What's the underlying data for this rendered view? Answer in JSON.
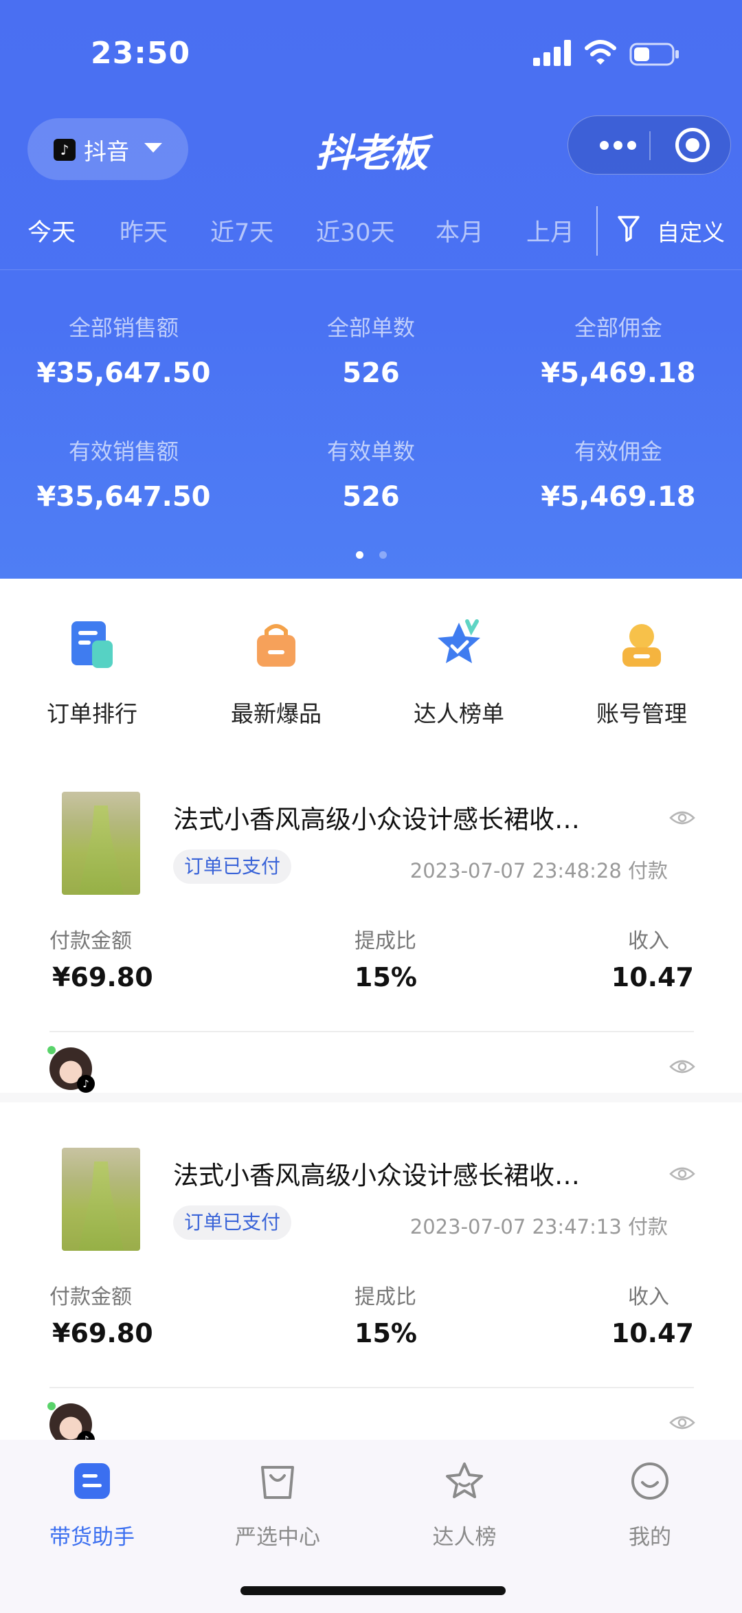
{
  "status_bar": {
    "time": "23:50"
  },
  "top_bar": {
    "platform": "抖音",
    "platform_badge": "♪",
    "app_name": "抖老板"
  },
  "date_tabs": [
    "今天",
    "昨天",
    "近7天",
    "近30天",
    "本月",
    "上月"
  ],
  "filter": {
    "label": "自定义"
  },
  "summary": [
    {
      "label": "全部销售额",
      "value": "¥35,647.50"
    },
    {
      "label": "全部单数",
      "value": "526"
    },
    {
      "label": "全部佣金",
      "value": "¥5,469.18"
    },
    {
      "label": "有效销售额",
      "value": "¥35,647.50"
    },
    {
      "label": "有效单数",
      "value": "526"
    },
    {
      "label": "有效佣金",
      "value": "¥5,469.18"
    }
  ],
  "quick_menu": [
    {
      "label": "订单排行",
      "icon": "document-icon"
    },
    {
      "label": "最新爆品",
      "icon": "shopping-bag-icon"
    },
    {
      "label": "达人榜单",
      "icon": "star-badge-icon"
    },
    {
      "label": "账号管理",
      "icon": "user-card-icon"
    }
  ],
  "orders": [
    {
      "title": "法式小香风高级小众设计感长裙收…",
      "status": "订单已支付",
      "paid_time": "2023-07-07 23:48:28 付款",
      "payment_label": "付款金额",
      "payment": "¥69.80",
      "rate_label": "提成比",
      "rate": "15%",
      "income_label": "收入",
      "income": "10.47"
    },
    {
      "title": "法式小香风高级小众设计感长裙收…",
      "status": "订单已支付",
      "paid_time": "2023-07-07 23:47:13 付款",
      "payment_label": "付款金额",
      "payment": "¥69.80",
      "rate_label": "提成比",
      "rate": "15%",
      "income_label": "收入",
      "income": "10.47"
    }
  ],
  "tab_bar": [
    {
      "label": "带货助手",
      "icon": "assistant-icon",
      "active": true
    },
    {
      "label": "严选中心",
      "icon": "bag-icon",
      "active": false
    },
    {
      "label": "达人榜",
      "icon": "star-icon",
      "active": false
    },
    {
      "label": "我的",
      "icon": "smile-icon",
      "active": false
    }
  ],
  "colors": {
    "primary": "#4a6ff2",
    "accent": "#3b6ff0",
    "tag_text": "#3a64d8"
  }
}
